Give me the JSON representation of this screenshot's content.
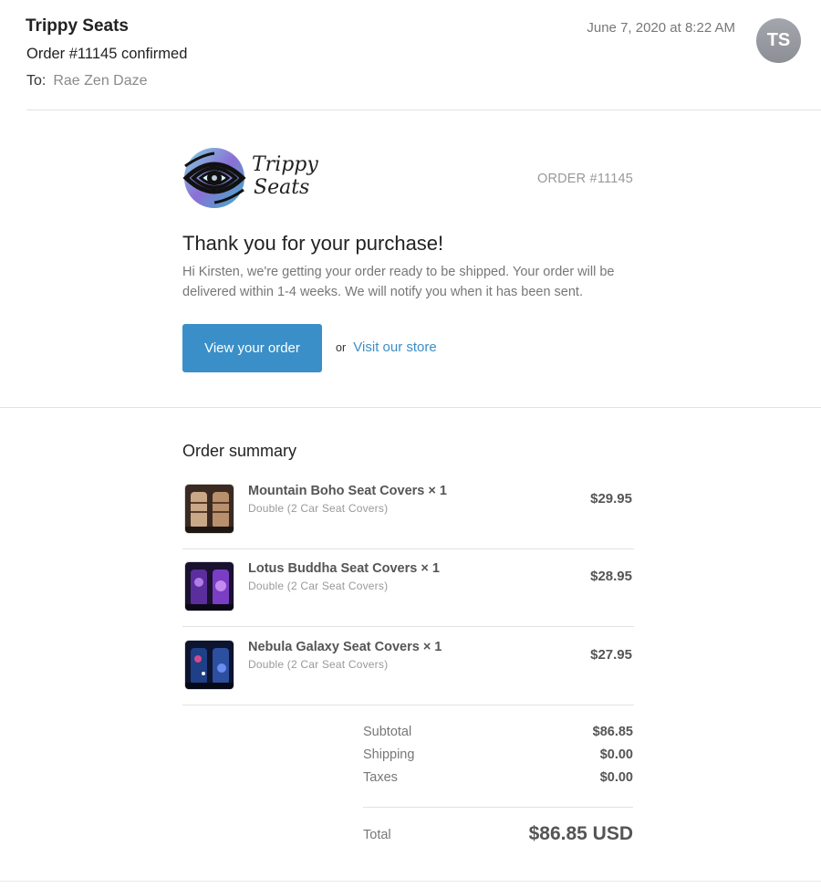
{
  "mail": {
    "sender": "Trippy Seats",
    "subject": "Order #11145 confirmed",
    "to_label": "To:",
    "to_name": "Rae Zen Daze",
    "date": "June 7, 2020 at 8:22 AM",
    "avatar_initials": "TS"
  },
  "brand": {
    "logo_line1": "Trippy",
    "logo_line2": "Seats",
    "order_number": "ORDER #11145"
  },
  "message": {
    "title": "Thank you for your purchase!",
    "body": "Hi Kirsten, we're getting your order ready to be shipped. Your order will be delivered within 1-4 weeks. We will notify you when it has been sent.",
    "button_label": "View your order",
    "or_text": "or",
    "store_link": "Visit our store"
  },
  "summary": {
    "title": "Order summary",
    "items": [
      {
        "name": "Mountain Boho Seat Covers × 1",
        "variant": "Double (2 Car Seat Covers)",
        "price": "$29.95"
      },
      {
        "name": "Lotus Buddha Seat Covers × 1",
        "variant": "Double (2 Car Seat Covers)",
        "price": "$28.95"
      },
      {
        "name": "Nebula Galaxy Seat Covers × 1",
        "variant": "Double (2 Car Seat Covers)",
        "price": "$27.95"
      }
    ],
    "subtotal_label": "Subtotal",
    "subtotal": "$86.85",
    "shipping_label": "Shipping",
    "shipping": "$0.00",
    "taxes_label": "Taxes",
    "taxes": "$0.00",
    "total_label": "Total",
    "total": "$86.85 USD"
  },
  "colors": {
    "accent": "#3a8fc8",
    "avatar": "#979aa1"
  }
}
